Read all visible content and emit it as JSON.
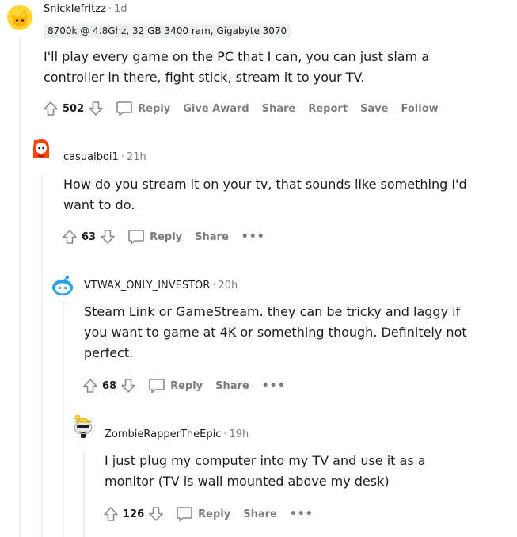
{
  "comments": [
    {
      "author": "SnickIefritzz",
      "sep": "·",
      "time": "1d",
      "flair": "8700k @ 4.8Ghz, 32 GB 3400 ram, Gigabyte 3070",
      "body_lines": [
        "I'll play every game on the PC that I can, you can just slam a",
        "controller in there, fight stick, stream it to your TV."
      ],
      "score": "502",
      "actions": [
        "Reply",
        "Give Award",
        "Share",
        "Report",
        "Save",
        "Follow"
      ]
    },
    {
      "author": "casualboi1",
      "sep": "·",
      "time": "21h",
      "body_lines": [
        "How do you stream it on your tv, that sounds like something I'd",
        "want to do."
      ],
      "score": "63",
      "actions": [
        "Reply",
        "Share"
      ],
      "more": "•••"
    },
    {
      "author": "VTWAX_ONLY_INVESTOR",
      "sep": "·",
      "time": "20h",
      "body_lines": [
        "Steam Link or GameStream. they can be tricky and laggy if",
        "you want to game at 4K or something though. Definitely not",
        "perfect."
      ],
      "score": "68",
      "actions": [
        "Reply",
        "Share"
      ],
      "more": "•••"
    },
    {
      "author": "ZombieRapperTheEpic",
      "sep": "·",
      "time": "19h",
      "body_lines": [
        "I just plug my computer into my TV and use it as a",
        "monitor (TV is wall mounted above my desk)"
      ],
      "score": "126",
      "actions": [
        "Reply",
        "Share"
      ],
      "more": "•••"
    }
  ],
  "icons": {
    "upvote": "upvote-arrow-icon",
    "downvote": "downvote-arrow-icon",
    "reply": "speech-bubble-icon"
  },
  "colors": {
    "meta_gray": "#7c7c7c",
    "thread_line": "#edeff1",
    "flair_bg": "#edeff1",
    "avatar_orange": "#ff4500",
    "avatar_yellow": "#ffd635",
    "avatar_blue": "#0dd3bb"
  }
}
